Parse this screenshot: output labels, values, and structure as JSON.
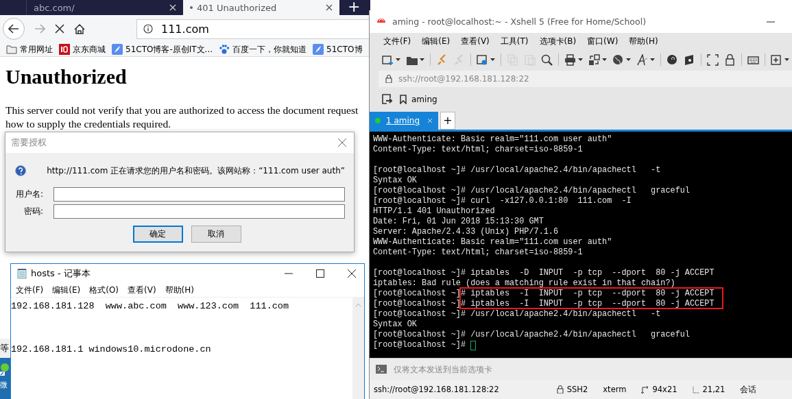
{
  "browser": {
    "tabs": [
      {
        "label": "abc.com/",
        "selected": false
      },
      {
        "label": "401 Unauthorized",
        "selected": true
      }
    ],
    "new_tab": "+",
    "address": "111.com",
    "bookmarks": [
      {
        "label": "常用网址",
        "kind": "folder"
      },
      {
        "label": "京东商城",
        "kind": "jd"
      },
      {
        "label": "51CTO博客-原创IT文...",
        "kind": "feather"
      },
      {
        "label": "百度一下，你就知道",
        "kind": "paw"
      },
      {
        "label": "51CTO博",
        "kind": "feather"
      }
    ],
    "page": {
      "heading": "Unauthorized",
      "lines": [
        "This server could not verify that you are authorized to access the document request",
        "how to supply the credentials required."
      ]
    }
  },
  "auth_dialog": {
    "title": "需要授权",
    "message": "http://111.com 正在请求您的用户名和密码。该网站称：“111.com user auth”",
    "fields": [
      {
        "label": "用户名:"
      },
      {
        "label": "密码:"
      }
    ],
    "buttons": [
      {
        "label": "确定",
        "default": true
      },
      {
        "label": "取消",
        "default": false
      }
    ]
  },
  "notepad": {
    "title": "hosts - 记事本",
    "menu": [
      "文件(F)",
      "编辑(E)",
      "格式(O)",
      "查看(V)",
      "帮助(H)"
    ],
    "lines": [
      {
        "kind": "text",
        "text": "192.168.181.128  www.abc.com  www.123.com  111.com"
      },
      {
        "kind": "blank"
      },
      {
        "kind": "blank"
      },
      {
        "kind": "text",
        "text": "192.168.181.1 windows10.microdone.cn"
      }
    ]
  },
  "desktop": {
    "behind_text": "等",
    "icon_label": "微"
  },
  "xshell": {
    "title": "aming - root@localhost:~ - Xshell 5 (Free for Home/School)",
    "menu": [
      "文件(F)",
      "编辑(E)",
      "查看(V)",
      "工具(T)",
      "选项卡(B)",
      "窗口(W)",
      "帮助(H)"
    ],
    "address": "ssh://root@192.168.181.128:22",
    "link": "aming",
    "tabs": [
      {
        "label": "1 aming",
        "selected": true,
        "connected": true
      }
    ],
    "add_tab": "+",
    "terminal": [
      {
        "highlighted": false,
        "lines": [
          {
            "kind": "text",
            "text": "WWW-Authenticate: Basic realm=\"111.com user auth\""
          },
          {
            "kind": "text",
            "text": "Content-Type: text/html; charset=iso-8859-1"
          },
          {
            "kind": "blank"
          },
          {
            "kind": "text",
            "text": "[root@localhost ~]# /usr/local/apache2.4/bin/apachectl   -t"
          },
          {
            "kind": "text",
            "text": "Syntax OK"
          },
          {
            "kind": "text",
            "text": "[root@localhost ~]# /usr/local/apache2.4/bin/apachectl   graceful"
          },
          {
            "kind": "text",
            "text": "[root@localhost ~]# curl  -x127.0.0.1:80  111.com  -I"
          },
          {
            "kind": "text",
            "text": "HTTP/1.1 401 Unauthorized"
          },
          {
            "kind": "text",
            "text": "Date: Fri, 01 Jun 2018 15:13:30 GMT"
          },
          {
            "kind": "text",
            "text": "Server: Apache/2.4.33 (Unix) PHP/7.1.6"
          },
          {
            "kind": "text",
            "text": "WWW-Authenticate: Basic realm=\"111.com user auth\""
          },
          {
            "kind": "text",
            "text": "Content-Type: text/html; charset=iso-8859-1"
          },
          {
            "kind": "blank"
          },
          {
            "kind": "text",
            "text": "[root@localhost ~]# iptables  -D  INPUT  -p tcp  --dport  80 -j ACCEPT"
          },
          {
            "kind": "text",
            "text": "iptables: Bad rule (does a matching rule exist in that chain?)"
          }
        ]
      },
      {
        "highlighted": true,
        "lines": [
          {
            "kind": "text",
            "text": "[root@localhost ~]# iptables  -I  INPUT  -p tcp  --dport  80 -j ACCEPT"
          },
          {
            "kind": "text",
            "text": "[root@localhost ~]# iptables  -I  INPUT  -p tcp  --dport  80 -j ACCEPT"
          }
        ]
      },
      {
        "highlighted": false,
        "lines": [
          {
            "kind": "text",
            "text": "[root@localhost ~]# /usr/local/apache2.4/bin/apachectl   -t"
          },
          {
            "kind": "text",
            "text": "Syntax OK"
          },
          {
            "kind": "text",
            "text": "[root@localhost ~]# /usr/local/apache2.4/bin/apachectl   graceful"
          },
          {
            "kind": "text",
            "text": "[root@localhost ~]# ",
            "cursor": true
          }
        ]
      }
    ],
    "compose": {
      "placeholder": "仅将文本发送到当前选项卡"
    },
    "status": [
      {
        "label": "ssh://root@192.168.181.128:22",
        "kind": "text"
      },
      {
        "label": "SSH2",
        "kind": "lock"
      },
      {
        "label": "xterm",
        "kind": "text"
      },
      {
        "label": "94x21",
        "kind": "size"
      },
      {
        "label": "21,21",
        "kind": "cursor"
      },
      {
        "label": "会话",
        "kind": "text"
      }
    ]
  }
}
